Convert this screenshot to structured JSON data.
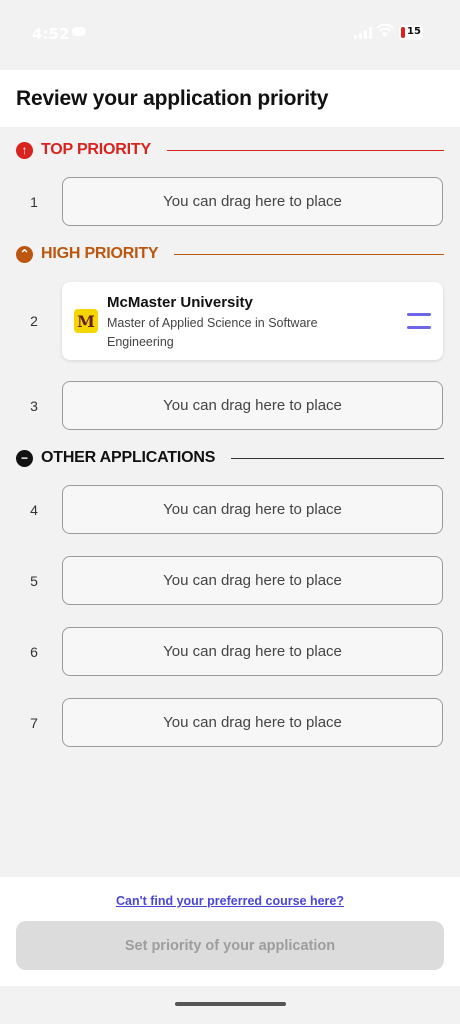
{
  "status_bar": {
    "time": "4:52",
    "battery": "15"
  },
  "header": {
    "title": "Review your application priority"
  },
  "sections": {
    "top": {
      "title": "TOP PRIORITY",
      "icon": "arrow-up-circle-icon",
      "color": "#d9231e"
    },
    "high": {
      "title": "HIGH PRIORITY",
      "icon": "chevron-up-circle-icon",
      "color": "#bd560f"
    },
    "other": {
      "title": "OTHER APPLICATIONS",
      "icon": "minus-circle-icon",
      "color": "#111111"
    }
  },
  "slots": [
    {
      "number": "1",
      "placeholder": "You can drag here to place"
    },
    {
      "number": "2"
    },
    {
      "number": "3",
      "placeholder": "You can drag here to place"
    },
    {
      "number": "4",
      "placeholder": "You can drag here to place"
    },
    {
      "number": "5",
      "placeholder": "You can drag here to place"
    },
    {
      "number": "6",
      "placeholder": "You can drag here to place"
    },
    {
      "number": "7",
      "placeholder": "You can drag here to place"
    }
  ],
  "application_card": {
    "logo_letter": "M",
    "university": "McMaster University",
    "program": "Master of Applied Science in Software Engineering"
  },
  "footer": {
    "link": "Can't find your preferred course here?",
    "button": "Set priority of your application"
  }
}
